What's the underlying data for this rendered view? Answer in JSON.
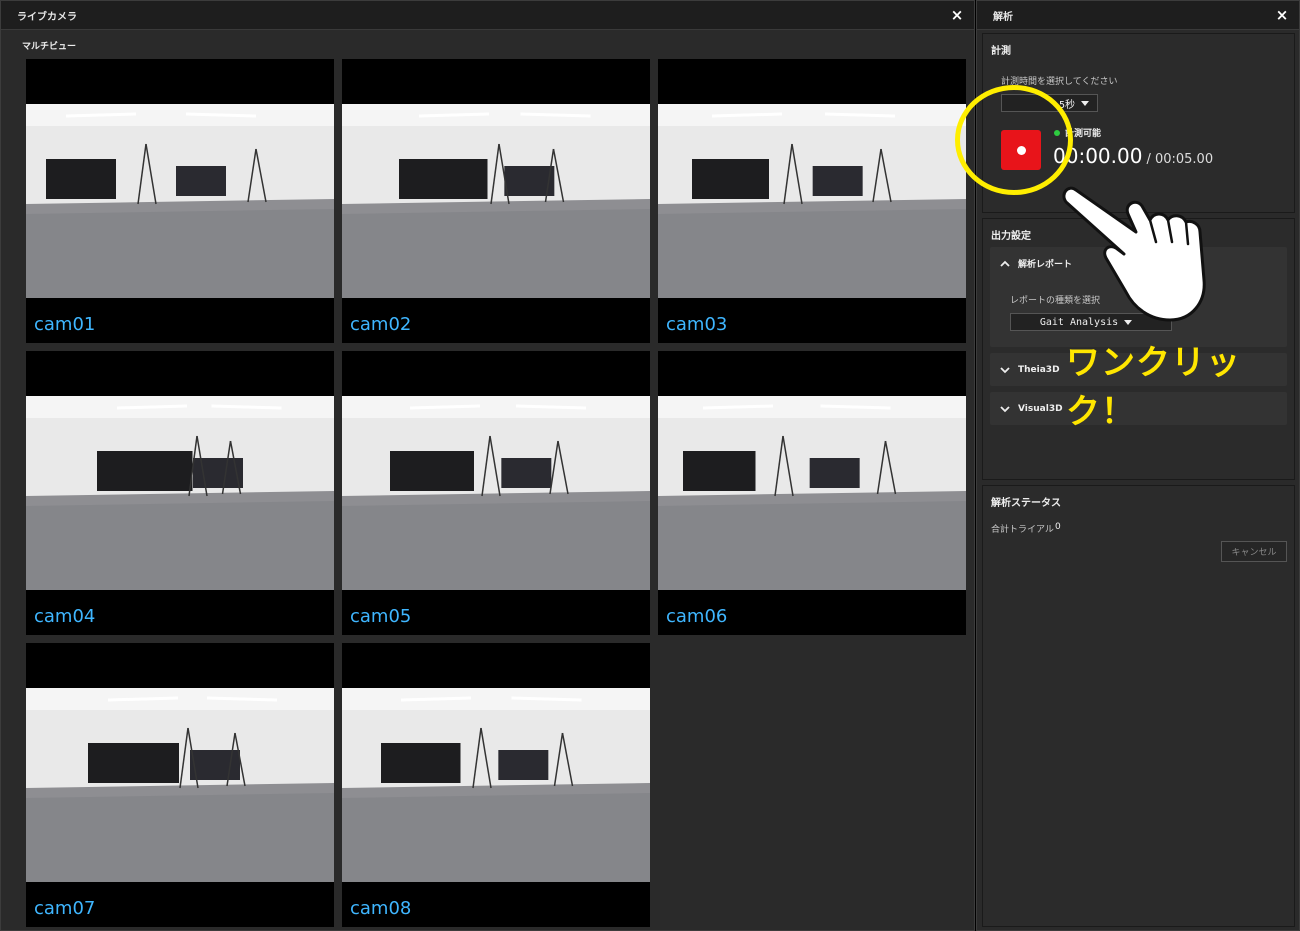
{
  "live_camera": {
    "title": "ライブカメラ",
    "close": "×",
    "multiview_label": "マルチビュー",
    "cameras": [
      "cam01",
      "cam02",
      "cam03",
      "cam04",
      "cam05",
      "cam06",
      "cam07",
      "cam08"
    ]
  },
  "analysis": {
    "title": "解析",
    "close": "×",
    "measurement": {
      "title": "計測",
      "select_time_label": "計測時間を選択してください",
      "time_value": "5秒",
      "status": "計測可能",
      "elapsed": "00:00.00",
      "total": "/ 00:05.00"
    },
    "output": {
      "title": "出力設定",
      "report": {
        "header": "解析レポート",
        "select_label": "レポートの種類を選択",
        "selected": "Gait Analysis"
      },
      "theia": "Theia3D",
      "visual": "Visual3D"
    },
    "status": {
      "title": "解析ステータス",
      "trials_label": "合計トライアル",
      "trials_value": "0",
      "cancel": "キャンセル"
    }
  },
  "annotation": {
    "text": "ワンクリック！"
  },
  "colors": {
    "record_button": "#e8141a",
    "cam_label": "#3fb6ff",
    "annotation": "#ffee00",
    "status_ok": "#2ecc40"
  }
}
